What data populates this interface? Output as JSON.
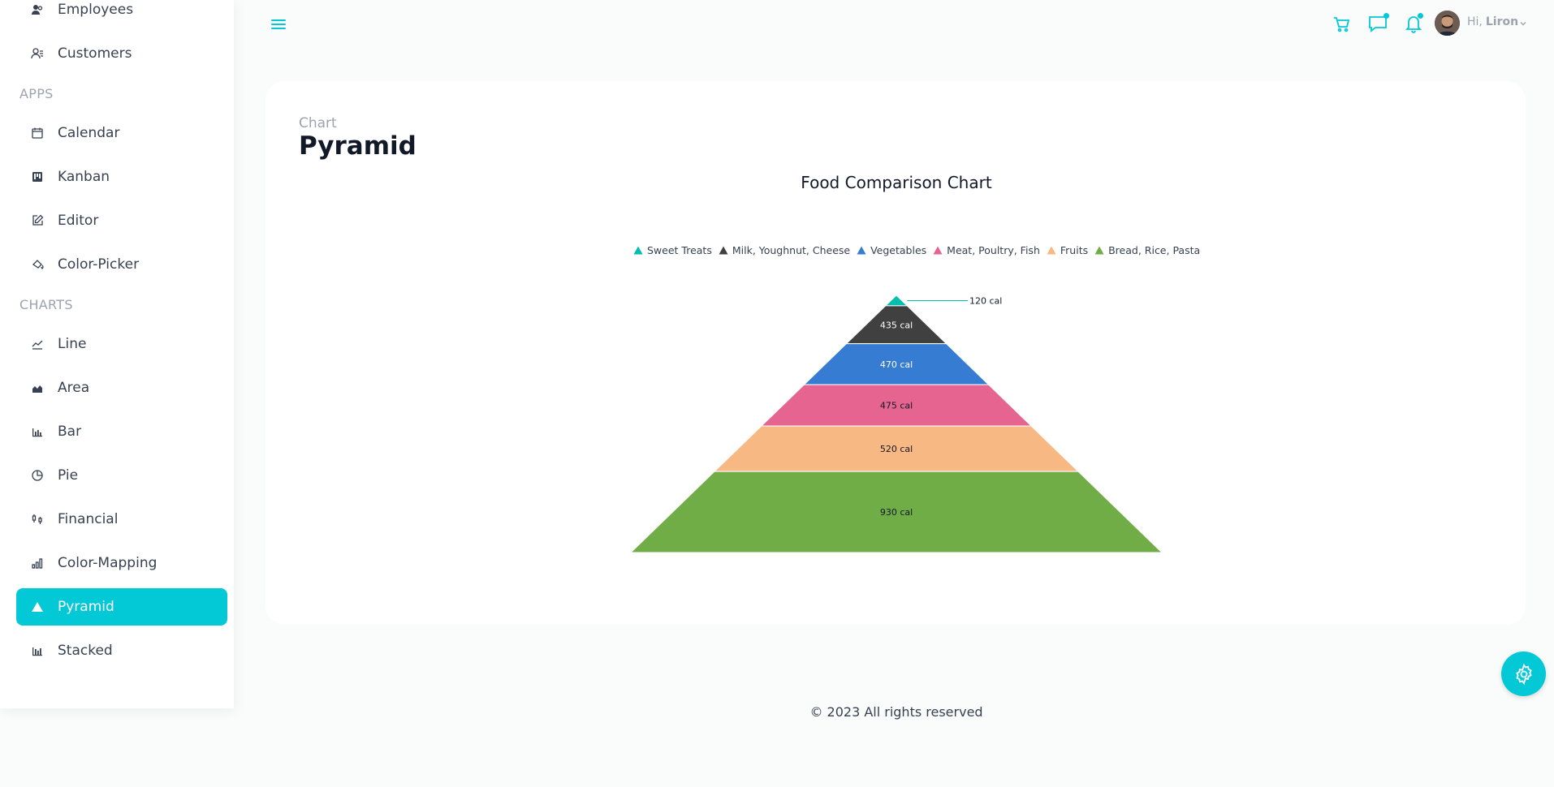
{
  "sidebar": {
    "items_top": [
      {
        "label": "Employees",
        "icon": "employees-icon"
      },
      {
        "label": "Customers",
        "icon": "customers-icon"
      }
    ],
    "apps_title": "APPS",
    "apps": [
      {
        "label": "Calendar",
        "icon": "calendar-icon"
      },
      {
        "label": "Kanban",
        "icon": "kanban-icon"
      },
      {
        "label": "Editor",
        "icon": "editor-icon"
      },
      {
        "label": "Color-Picker",
        "icon": "color-picker-icon"
      }
    ],
    "charts_title": "CHARTS",
    "charts": [
      {
        "label": "Line",
        "icon": "line-chart-icon"
      },
      {
        "label": "Area",
        "icon": "area-chart-icon"
      },
      {
        "label": "Bar",
        "icon": "bar-chart-icon"
      },
      {
        "label": "Pie",
        "icon": "pie-chart-icon"
      },
      {
        "label": "Financial",
        "icon": "financial-icon"
      },
      {
        "label": "Color-Mapping",
        "icon": "color-mapping-icon"
      },
      {
        "label": "Pyramid",
        "icon": "pyramid-icon",
        "active": true
      },
      {
        "label": "Stacked",
        "icon": "stacked-chart-icon"
      }
    ]
  },
  "navbar": {
    "greeting": "Hi,",
    "user_name": "Liron",
    "icons": [
      "menu-icon",
      "cart-icon",
      "chat-icon",
      "notification-icon",
      "chevron-down-icon"
    ]
  },
  "page": {
    "breadcrumb": "Chart",
    "title": "Pyramid"
  },
  "colors": {
    "accent": "#03c9d7"
  },
  "chart_data": {
    "type": "pyramid",
    "title": "Food Comparison Chart",
    "legend_position": "top",
    "series": [
      {
        "name": "Sweet Treats",
        "value": 120,
        "label": "120 cal",
        "color": "#00bdae"
      },
      {
        "name": "Milk, Youghnut, Cheese",
        "value": 435,
        "label": "435 cal",
        "color": "#404041"
      },
      {
        "name": "Vegetables",
        "value": 470,
        "label": "470 cal",
        "color": "#357cd2"
      },
      {
        "name": "Meat, Poultry, Fish",
        "value": 475,
        "label": "475 cal",
        "color": "#e56590"
      },
      {
        "name": "Fruits",
        "value": 520,
        "label": "520 cal",
        "color": "#f8b883"
      },
      {
        "name": "Bread, Rice, Pasta",
        "value": 930,
        "label": "930 cal",
        "color": "#70ad47"
      }
    ]
  },
  "footer": {
    "text": "© 2023 All rights reserved"
  }
}
